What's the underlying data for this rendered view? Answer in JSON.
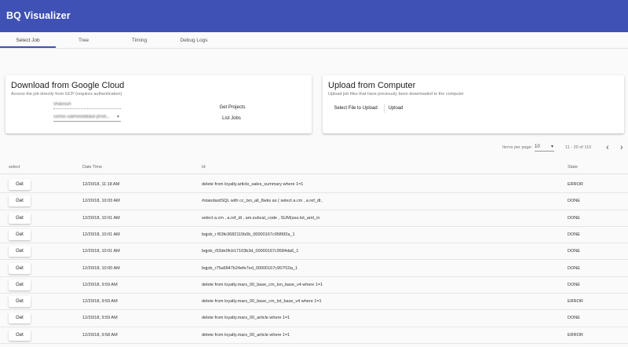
{
  "app": {
    "title": "BQ Visualizer"
  },
  "tabs": [
    {
      "label": "Select Job",
      "active": true
    },
    {
      "label": "Tree"
    },
    {
      "label": "Timing"
    },
    {
      "label": "Debug Logs"
    }
  ],
  "download_card": {
    "title": "Download from Google Cloud",
    "subtitle": "Access the job directly from GCP (requires authentication)",
    "project_field_value": "shaosun",
    "location_select_value": "conoc-uamoodataut-prod...",
    "get_projects_label": "Get Projects",
    "list_jobs_label": "List Jobs"
  },
  "upload_card": {
    "title": "Upload from Computer",
    "subtitle": "Upload job files that have previously been downloaded to the computer",
    "select_file_label": "Select File to Upload",
    "upload_label": "Upload"
  },
  "pager": {
    "items_per_page_label": "Items per page:",
    "items_per_page_value": "10",
    "range_label": "11 - 20 of 110",
    "prev_icon": "chevron-left-icon",
    "next_icon": "chevron-right-icon"
  },
  "table": {
    "columns": [
      "select",
      "Date Time",
      "Id",
      "State"
    ],
    "get_label": "Get",
    "rows": [
      {
        "datetime": "12/20/18, 11:18 AM",
        "id": "delete from loyalty.article_sales_summary where 1=1",
        "state": "ERROR"
      },
      {
        "datetime": "12/20/18, 10:03 AM",
        "id": "#standardSQL with cc_txn_all_8wks as ( select a.cm , a.ref_dt ,",
        "state": "DONE"
      },
      {
        "datetime": "12/20/18, 10:01 AM",
        "id": "select a.cm , a.ref_dt , am.subcat_code , SUM(ass.tot_amt_in",
        "state": "DONE"
      },
      {
        "datetime": "12/20/18, 10:01 AM",
        "id": "bqjob_r f63fe3682115b0b_00000167c9586f2a_1",
        "state": "DONE"
      },
      {
        "datetime": "12/20/18, 10:01 AM",
        "id": "bqjob_r53de0fcb17103b3d_00000167c9584da6_1",
        "state": "DONE"
      },
      {
        "datetime": "12/20/18, 10:00 AM",
        "id": "bqjob_r75a6847b24efe7ed_00000167c957f10a_1",
        "state": "DONE"
      },
      {
        "datetime": "12/20/18, 9:59 AM",
        "id": "delete from loyalty.mars_00_base_cm_txn_base_v4 where 1=1",
        "state": "DONE"
      },
      {
        "datetime": "12/20/18, 9:59 AM",
        "id": "delete from loyalty.mars_00_base_cm_txt_base_v4 where 1=1",
        "state": "ERROR"
      },
      {
        "datetime": "12/20/18, 9:59 AM",
        "id": "delete from loyalty.mars_00_article where 1=1",
        "state": "DONE"
      },
      {
        "datetime": "12/20/18, 9:58 AM",
        "id": "delete from loyalty.mars_00_article where 1=1",
        "state": "ERROR"
      }
    ]
  },
  "colors": {
    "appbar": "#3f51b5",
    "background": "#fafafa"
  }
}
